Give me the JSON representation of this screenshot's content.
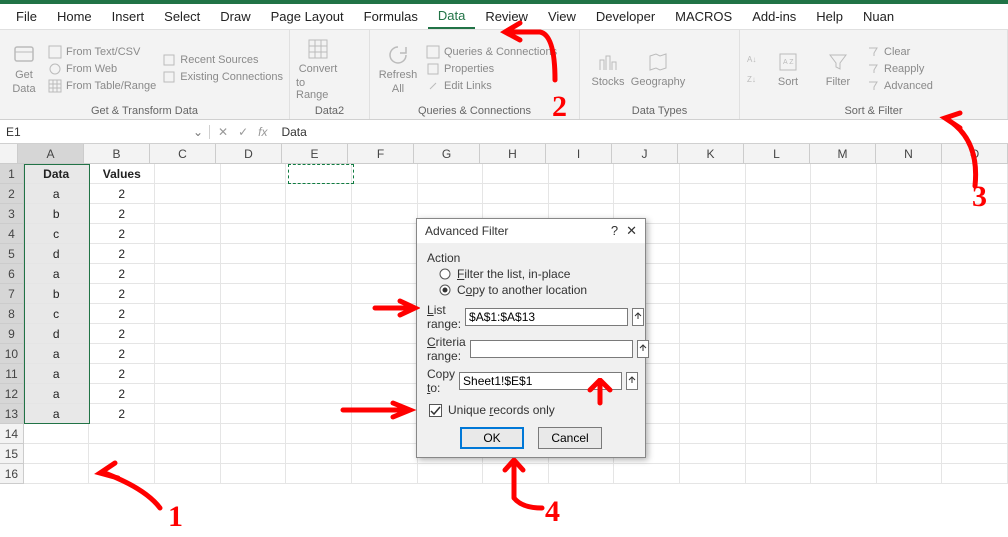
{
  "tabs": [
    "File",
    "Home",
    "Insert",
    "Select",
    "Draw",
    "Page Layout",
    "Formulas",
    "Data",
    "Review",
    "View",
    "Developer",
    "MACROS",
    "Add-ins",
    "Help",
    "Nuan"
  ],
  "active_tab": "Data",
  "ribbon": {
    "g1": {
      "big": [
        "Get",
        "Data"
      ],
      "items": [
        "From Text/CSV",
        "From Web",
        "From Table/Range",
        "Recent Sources",
        "Existing Connections"
      ],
      "label": "Get & Transform Data"
    },
    "g2": {
      "big": [
        "Convert",
        "to Range"
      ],
      "label": "Data2"
    },
    "g3": {
      "big": [
        "Refresh",
        "All"
      ],
      "items": [
        "Queries & Connections",
        "Properties",
        "Edit Links"
      ],
      "label": "Queries & Connections"
    },
    "g4": {
      "items": [
        "Stocks",
        "Geography"
      ],
      "label": "Data Types"
    },
    "g5": {
      "sort_label": "Sort",
      "filter_label": "Filter",
      "items": [
        "Clear",
        "Reapply",
        "Advanced"
      ],
      "label": "Sort & Filter"
    }
  },
  "namebox": "E1",
  "formula": "Data",
  "columns": [
    "A",
    "B",
    "C",
    "D",
    "E",
    "F",
    "G",
    "H",
    "I",
    "J",
    "K",
    "L",
    "M",
    "N",
    "O"
  ],
  "selected_col": "A",
  "table": {
    "headers": [
      "Data",
      "Values"
    ],
    "rows": [
      [
        "a",
        "2"
      ],
      [
        "b",
        "2"
      ],
      [
        "c",
        "2"
      ],
      [
        "d",
        "2"
      ],
      [
        "a",
        "2"
      ],
      [
        "b",
        "2"
      ],
      [
        "c",
        "2"
      ],
      [
        "d",
        "2"
      ],
      [
        "a",
        "2"
      ],
      [
        "a",
        "2"
      ],
      [
        "a",
        "2"
      ],
      [
        "a",
        "2"
      ]
    ]
  },
  "row_count": 16,
  "dialog": {
    "title": "Advanced Filter",
    "help": "?",
    "close": "✕",
    "action_label": "Action",
    "opt_inplace": "Filter the list, in-place",
    "opt_copyto": "Copy to another location",
    "selected_action": "copyto",
    "list_range_label": "List range:",
    "list_range": "$A$1:$A$13",
    "criteria_label": "Criteria range:",
    "criteria": "",
    "copyto_label": "Copy to:",
    "copyto": "Sheet1!$E$1",
    "unique_label": "Unique records only",
    "unique_checked": true,
    "ok": "OK",
    "cancel": "Cancel"
  },
  "annotations": {
    "n1": "1",
    "n2": "2",
    "n3": "3",
    "n4": "4"
  }
}
